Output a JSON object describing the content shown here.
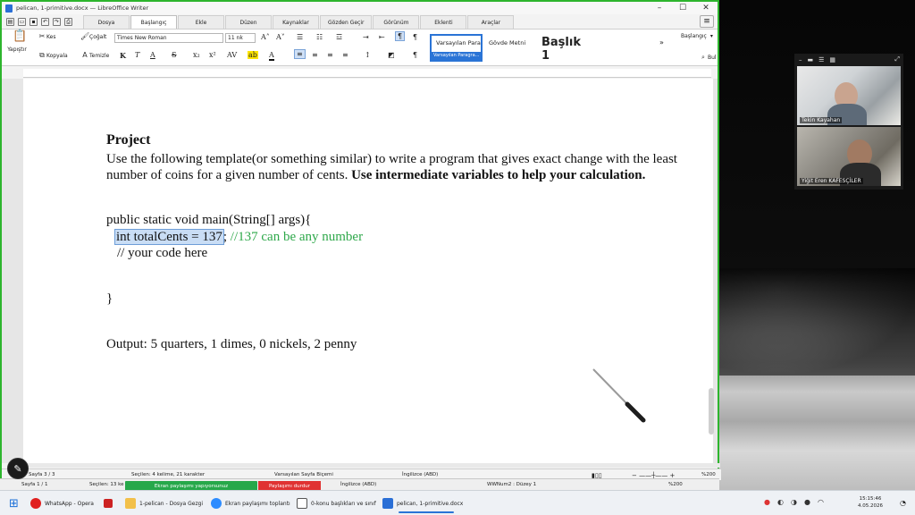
{
  "window": {
    "title": "pelican, 1-primitive.docx — LibreOffice Writer",
    "controls": [
      "–",
      "☐",
      "✕"
    ]
  },
  "tabs": [
    "Dosya",
    "Başlangıç",
    "Ekle",
    "Düzen",
    "Kaynaklar",
    "Gözden Geçir",
    "Görünüm",
    "Eklenti",
    "Araçlar"
  ],
  "active_tab": "Başlangıç",
  "ribbon": {
    "paste": "Yapıştır",
    "cut": "Kes",
    "copy": "Kopyala",
    "clone": "Çoğalt",
    "clear": "Temizle",
    "font_name": "Times New Roman",
    "font_size": "11 nk",
    "styles": {
      "default_para": "Varsayılan Para",
      "default_para_label": "Varsayılan Paragra...",
      "body_text": "Gövde Metni",
      "heading1": "Başlık 1"
    },
    "start_dropdown": "Başlangıç",
    "find": "Bul"
  },
  "document": {
    "heading": "Project",
    "para1_line1": "Use the following template(or something similar) to write a program that gives exact change with the least",
    "para1_line2": "number of coins for a given number of cents. ",
    "para1_bold": "Use intermediate variables to help your calculation.",
    "code_line1": "public static void main(String[] args){",
    "code_selected": "int totalCents = 137",
    "code_after_sel": ";  ",
    "code_comment": "//137 can be any number",
    "code_line3": "// your code here",
    "code_close": "}",
    "output": "Output: 5 quarters, 1 dimes, 0 nickels, 2 penny"
  },
  "status1": {
    "page": "Sayfa 3 / 3",
    "selection": "Seçilen: 4 kelime, 21 karakter",
    "page_style": "Varsayılan Sayfa Biçemi",
    "language": "İngilizce (ABD)",
    "zoom": "%200"
  },
  "status2": {
    "page": "Sayfa 1 / 1",
    "selection": "Seçilen: 13 ke",
    "language": "İngilizce (ABD)",
    "numbering": "WWNum2 : Düzey 1",
    "zoom": "%200"
  },
  "share": {
    "sharing": "Ekran paylaşımı yapıyorsunuz",
    "stop": "Paylaşımı durdur"
  },
  "zoom": {
    "participant1": "Tekin Kayahan",
    "participant2": "Yiğit Eren KAFESÇİLER"
  },
  "taskbar": {
    "items": [
      "WhatsApp - Opera",
      "1-pelican - Dosya Gezgi",
      "Ekran paylaşımı toplantı",
      "0-konu başlıkları ve sınıf",
      "pelican, 1-primitive.docx"
    ],
    "time": "15:15:46",
    "date": "4.05.2026"
  }
}
